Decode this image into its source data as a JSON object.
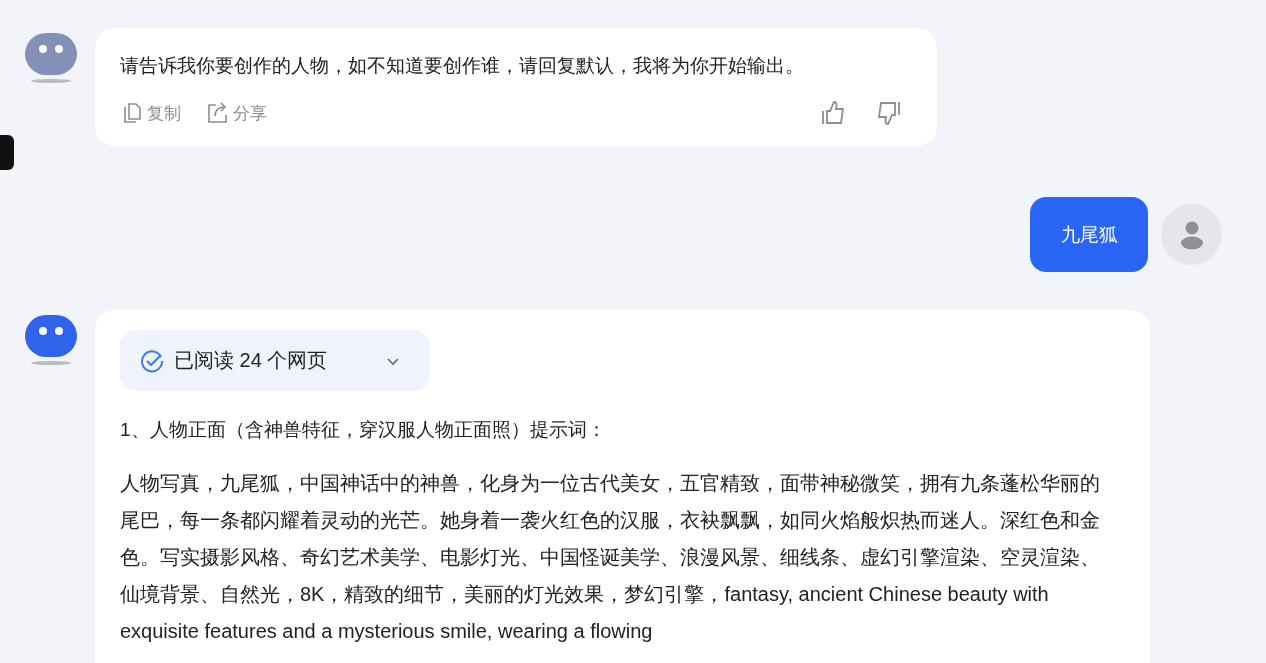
{
  "messages": [
    {
      "kind": "assistant",
      "text": "请告诉我你要创作的人物，如不知道要创作谁，请回复默认，我将为你开始输出。",
      "actions": [
        {
          "kind": "copy",
          "label": "复制"
        },
        {
          "kind": "share",
          "label": "分享"
        }
      ],
      "feedback": [
        {
          "kind": "like"
        },
        {
          "kind": "dislike"
        }
      ]
    },
    {
      "kind": "user",
      "text": "九尾狐"
    },
    {
      "kind": "assistant",
      "sources": {
        "label": "已阅读 24 个网页",
        "expanded": false
      },
      "heading": "1、人物正面（含神兽特征，穿汉服人物正面照）提示词：",
      "paragraph": "人物写真，九尾狐，中国神话中的神兽，化身为一位古代美女，五官精致，面带神秘微笑，拥有九条蓬松华丽的尾巴，每一条都闪耀着灵动的光芒。她身着一袭火红色的汉服，衣袂飘飘，如同火焰般炽热而迷人。深红色和金色。写实摄影风格、奇幻艺术美学、电影灯光、中国怪诞美学、浪漫风景、细线条、虚幻引擎渲染、空灵渲染、仙境背景、自然光，8K，精致的细节，美丽的灯光效果，梦幻引擎，fantasy, ancient Chinese beauty with exquisite features and a mysterious smile, wearing a flowing"
    }
  ]
}
